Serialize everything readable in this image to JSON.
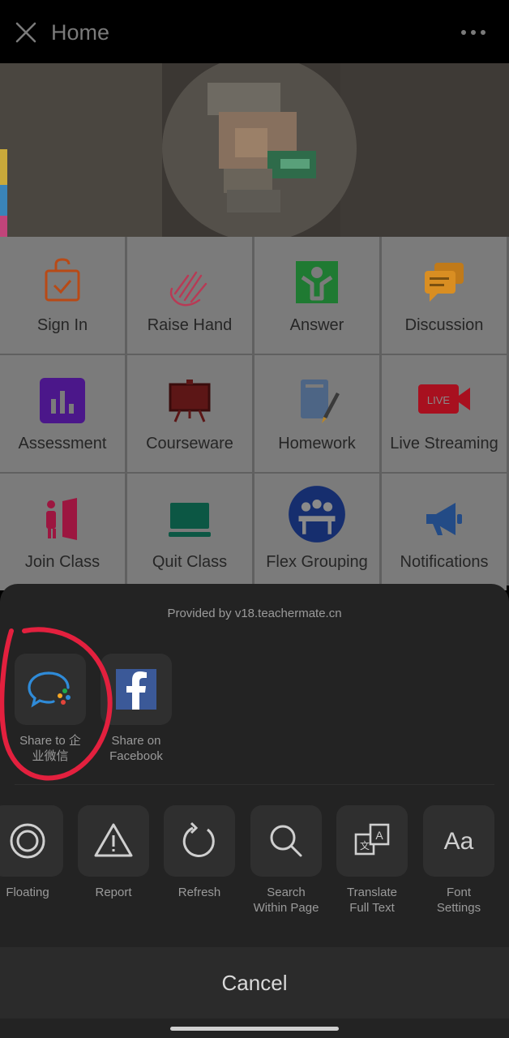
{
  "header": {
    "title": "Home",
    "close_icon": "close-icon",
    "more_icon": "more-horizontal-icon"
  },
  "grid": {
    "items": [
      {
        "label": "Sign In",
        "icon": "calendar-check-icon",
        "color": "#d35400"
      },
      {
        "label": "Raise Hand",
        "icon": "hand-icon",
        "color": "#e84b6d"
      },
      {
        "label": "Answer",
        "icon": "person-answer-icon",
        "color": "#1f9d3a"
      },
      {
        "label": "Discussion",
        "icon": "chat-bubbles-icon",
        "color": "#f5a623"
      },
      {
        "label": "Assessment",
        "icon": "bar-chart-icon",
        "color": "#6a1fb5"
      },
      {
        "label": "Courseware",
        "icon": "easel-icon",
        "color": "#8b1a1a"
      },
      {
        "label": "Homework",
        "icon": "notebook-pen-icon",
        "color": "#5f7aa0"
      },
      {
        "label": "Live Streaming",
        "icon": "live-video-icon",
        "color": "#d0182a"
      },
      {
        "label": "Join Class",
        "icon": "door-enter-icon",
        "color": "#c41e50"
      },
      {
        "label": "Quit Class",
        "icon": "laptop-icon",
        "color": "#0e6b54"
      },
      {
        "label": "Flex Grouping",
        "icon": "group-icon",
        "color": "#1c3a8a"
      },
      {
        "label": "Notifications",
        "icon": "megaphone-icon",
        "color": "#2d5fa8"
      }
    ]
  },
  "sheet": {
    "provided_by": "Provided by v18.teachermate.cn",
    "share": [
      {
        "label": "Share to 企\n业微信",
        "icon": "wecom-icon"
      },
      {
        "label": "Share on\nFacebook",
        "icon": "facebook-icon"
      }
    ],
    "actions": [
      {
        "label": "Floating",
        "icon": "floating-icon"
      },
      {
        "label": "Report",
        "icon": "warning-icon"
      },
      {
        "label": "Refresh",
        "icon": "refresh-icon"
      },
      {
        "label": "Search\nWithin Page",
        "icon": "search-icon"
      },
      {
        "label": "Translate\nFull Text",
        "icon": "translate-icon"
      },
      {
        "label": "Font\nSettings",
        "icon": "font-icon"
      }
    ],
    "cancel_label": "Cancel"
  },
  "colors": {
    "annotation": "#e3203e",
    "sheet_bg": "#232323",
    "overlay_grid": "#7b7b7b"
  }
}
